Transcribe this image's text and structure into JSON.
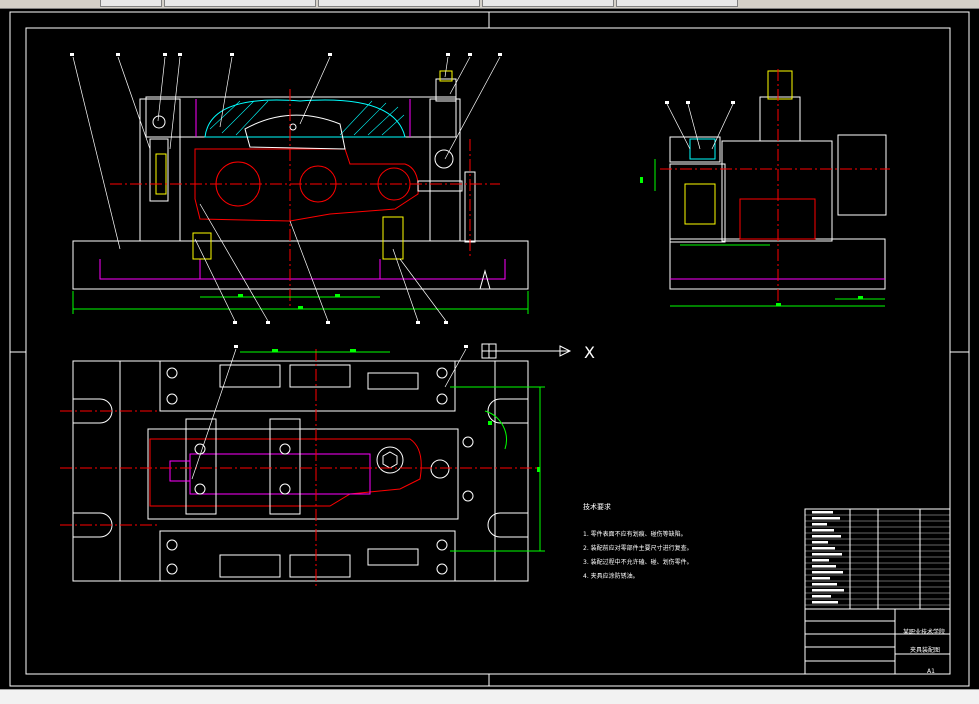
{
  "window": {
    "tabs": [
      "",
      "",
      "",
      "",
      ""
    ]
  },
  "viewport": {
    "ucs_axis_label": "X",
    "sheet_size": "A1"
  },
  "tech_notes": {
    "heading": "技术要求",
    "items": [
      "1. 零件表面不应有划痕、碰伤等缺陷。",
      "2. 装配前应对零部件主要尺寸进行复查。",
      "3. 装配过程中不允许磕、碰、划伤零件。",
      "4. 夹具应涂防锈油。"
    ]
  },
  "title_block": {
    "school": "某职业技术学院",
    "drawing_name": "夹具装配图",
    "scale_label": "A1"
  },
  "colors": {
    "background": "#000000",
    "frame": "#ffffff",
    "section": "#ff0000",
    "center": "#ff0000",
    "dimension": "#00ff00",
    "hidden": "#ff00ff",
    "hatch": "#00ffff",
    "thread": "#ffff00"
  }
}
